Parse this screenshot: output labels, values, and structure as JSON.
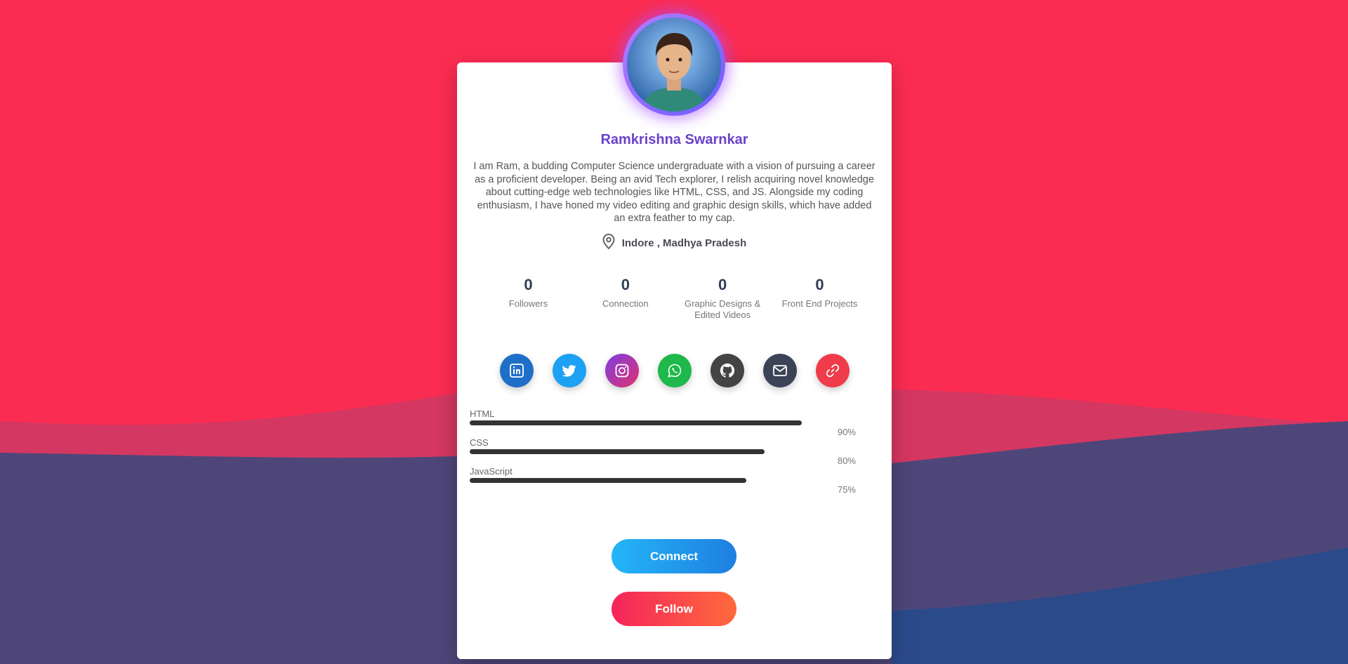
{
  "profile": {
    "name": "Ramkrishna Swarnkar",
    "bio": "I am Ram, a budding Computer Science undergraduate with a vision of pursuing a career as a proficient developer. Being an avid Tech explorer, I relish acquiring novel knowledge about cutting-edge web technologies like HTML, CSS, and JS. Alongside my coding enthusiasm, I have honed my video editing and graphic design skills, which have added an extra feather to my cap.",
    "location": "Indore , Madhya Pradesh"
  },
  "stats": [
    {
      "value": "0",
      "label": "Followers"
    },
    {
      "value": "0",
      "label": "Connection"
    },
    {
      "value": "0",
      "label": "Graphic Designs & Edited Videos"
    },
    {
      "value": "0",
      "label": "Front End Projects"
    }
  ],
  "socials": [
    {
      "name": "linkedin-icon",
      "color": "#1f6fc8"
    },
    {
      "name": "twitter-icon",
      "color": "#1da1f2"
    },
    {
      "name": "instagram-icon",
      "color": "#c13584"
    },
    {
      "name": "whatsapp-icon",
      "color": "#1fb84a"
    },
    {
      "name": "github-icon",
      "color": "#444444"
    },
    {
      "name": "mail-icon",
      "color": "#3b4456"
    },
    {
      "name": "link-icon",
      "color": "#f03b4b"
    }
  ],
  "skills": [
    {
      "label": "HTML",
      "percent": "90%",
      "level": 0.9
    },
    {
      "label": "CSS",
      "percent": "80%",
      "level": 0.8
    },
    {
      "label": "JavaScript",
      "percent": "75%",
      "level": 0.75
    }
  ],
  "buttons": {
    "connect": "Connect",
    "follow": "Follow"
  },
  "colors": {
    "background_top": "#fb2c52",
    "background_bottom": "#4e4679",
    "name": "#6a41c9",
    "connect_gradient": [
      "#24b5f7",
      "#1e7fe0"
    ],
    "follow_gradient": [
      "#f5245a",
      "#ff6a3c"
    ]
  }
}
